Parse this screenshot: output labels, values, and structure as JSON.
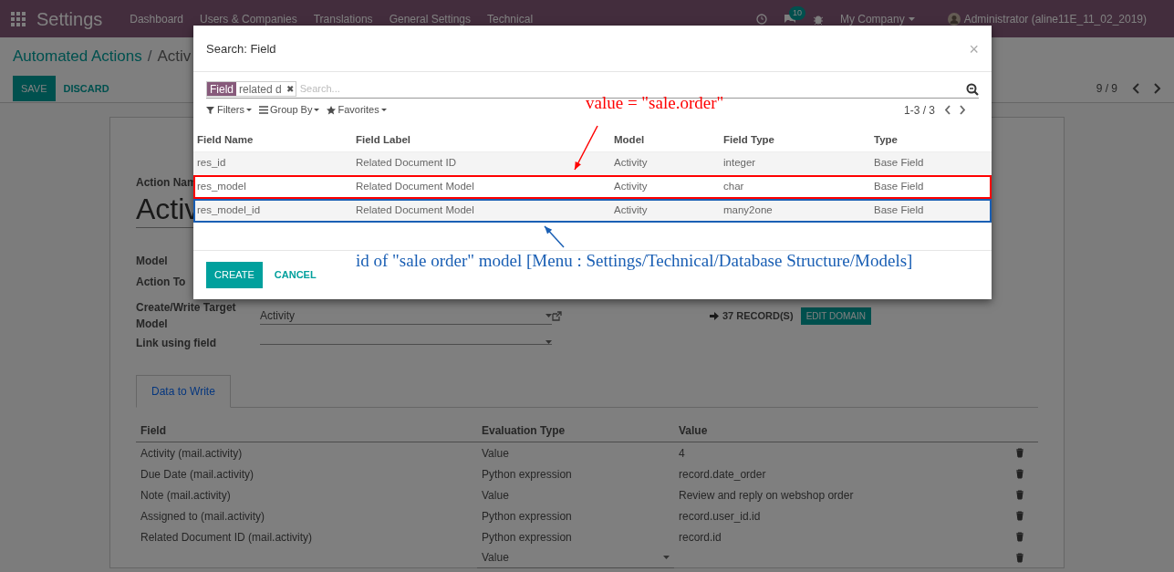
{
  "navbar": {
    "app_title": "Settings",
    "menu": [
      "Dashboard",
      "Users & Companies",
      "Translations",
      "General Settings",
      "Technical"
    ],
    "chat_badge": "10",
    "company": "My Company",
    "user": "Administrator (aline11E_11_02_2019)"
  },
  "control_panel": {
    "breadcrumb": [
      "Automated Actions",
      "Activ"
    ],
    "separator": "/",
    "buttons": [
      {
        "label": "SAVE",
        "kind": "primary"
      },
      {
        "label": "DISCARD",
        "kind": "link"
      }
    ],
    "pager": "9 / 9"
  },
  "form": {
    "action_name_label": "Action Nam",
    "action_name": "Activ",
    "fields": [
      {
        "label": "Model",
        "kind": "plain"
      },
      {
        "label": "Action To",
        "kind": "plain"
      },
      {
        "label": "Create/Write Target Model",
        "kind": "many2one",
        "value": "Activity"
      },
      {
        "label": "Link using field",
        "kind": "select"
      }
    ],
    "records": "37 RECORD(S)",
    "edit_domain": "EDIT DOMAIN",
    "tabs": [
      {
        "label": "Data to Write",
        "selected": true
      }
    ],
    "lines": {
      "columns": [
        "Field",
        "Evaluation Type",
        "Value"
      ],
      "rows": [
        {
          "kind": "line",
          "field": "Activity (mail.activity)",
          "evaluation_type": "Value",
          "value": "4"
        },
        {
          "kind": "line",
          "field": "Due Date (mail.activity)",
          "evaluation_type": "Python expression",
          "value": "record.date_order"
        },
        {
          "kind": "line",
          "field": "Note (mail.activity)",
          "evaluation_type": "Value",
          "value": "Review and reply on webshop order"
        },
        {
          "kind": "line",
          "field": "Assigned to (mail.activity)",
          "evaluation_type": "Python expression",
          "value": "record.user_id.id"
        },
        {
          "kind": "line",
          "field": "Related Document ID (mail.activity)",
          "evaluation_type": "Python expression",
          "value": "record.id"
        },
        {
          "kind": "editable",
          "evaluation_type": "Value"
        }
      ]
    }
  },
  "dialog": {
    "title": "Search: Field",
    "close": "×",
    "facet": {
      "label": "Field",
      "value": "related d",
      "remove": "✖"
    },
    "search_placeholder": "Search...",
    "filters": [
      "Filters",
      "Group By",
      "Favorites"
    ],
    "pager": "1-3 / 3",
    "columns": [
      "Field Name",
      "Field Label",
      "Model",
      "Field Type",
      "Type"
    ],
    "rows": [
      {
        "cells": [
          "res_id",
          "Related Document ID",
          "Activity",
          "integer",
          "Base Field"
        ]
      },
      {
        "cells": [
          "res_model",
          "Related Document Model",
          "Activity",
          "char",
          "Base Field"
        ],
        "color": "#ff0000"
      },
      {
        "cells": [
          "res_model_id",
          "Related Document Model",
          "Activity",
          "many2one",
          "Base Field"
        ],
        "color": "#1a5fb4"
      }
    ],
    "buttons": [
      {
        "label": "CREATE",
        "kind": "primary"
      },
      {
        "label": "CANCEL",
        "kind": "link"
      }
    ],
    "annotations": [
      {
        "text": "value = \"sale.order\"",
        "color": "#ff0000"
      },
      {
        "text": "id of \"sale order\" model [Menu : Settings/Technical/Database Structure/Models]",
        "color": "#1a5fb4"
      }
    ]
  }
}
